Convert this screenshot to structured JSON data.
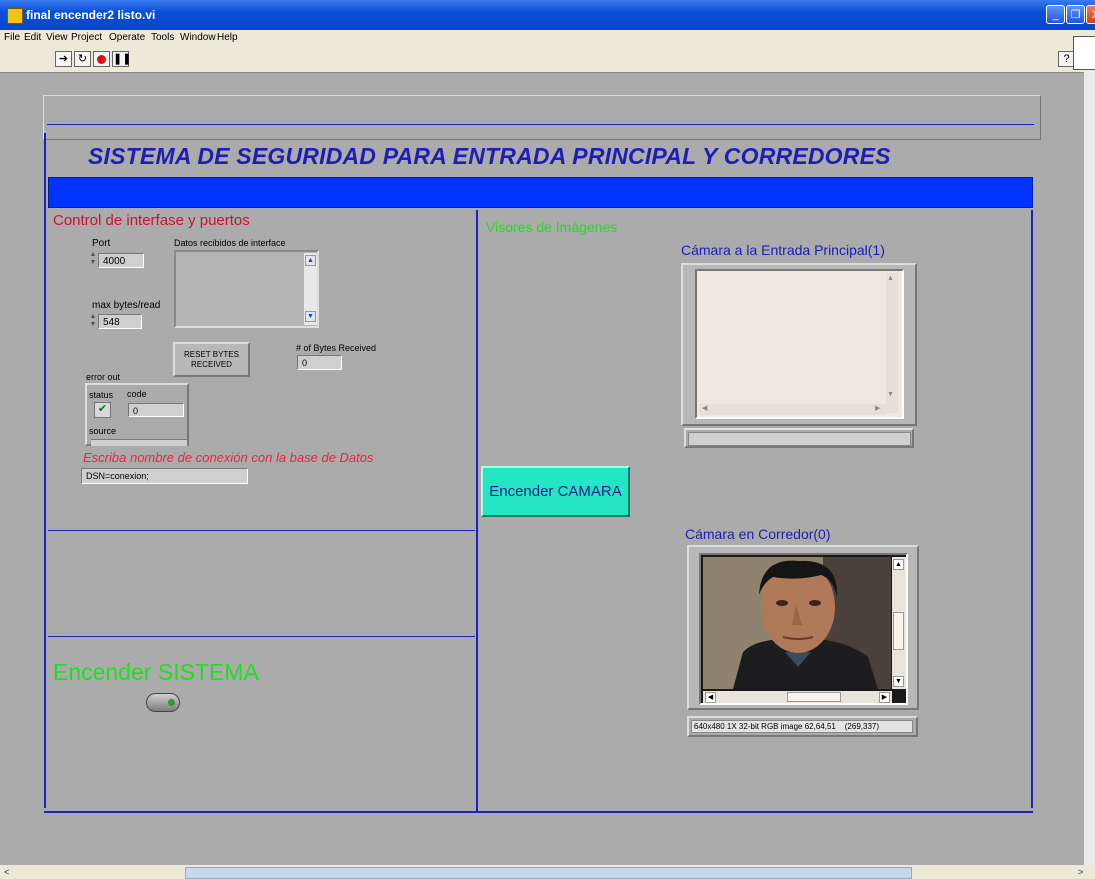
{
  "window": {
    "title": "final encender2 listo.vi",
    "controls": [
      "_",
      "❐",
      "X"
    ]
  },
  "menu": [
    "File",
    "Edit",
    "View",
    "Project",
    "Operate",
    "Tools",
    "Window",
    "Help"
  ],
  "panel": {
    "title": "SISTEMA DE SEGURIDAD PARA  ENTRADA PRINCIPAL Y CORREDORES",
    "left_section": {
      "heading": "Control de interfase y puertos",
      "port_label": "Port",
      "port_value": "4000",
      "max_bytes_label": "max bytes/read",
      "max_bytes_value": "548",
      "datos_label": "Datos recibidos de interface",
      "reset_button": "RESET BYTES RECEIVED",
      "bytes_received_label": "# of Bytes Received",
      "bytes_received_value": "0",
      "error_out": {
        "label": "error out",
        "status_label": "status",
        "code_label": "code",
        "code_value": "0",
        "source_label": "source"
      },
      "db_prompt": "Escriba nombre de conexión con la base de Datos",
      "db_value": "DSN=conexion;",
      "system_label": "Encender SISTEMA"
    },
    "right_section": {
      "heading": "Visores de Imágenes",
      "camera1_title": "Cámara a la Entrada Principal(1)",
      "camera0_title": "Cámara en Corredor(0)",
      "camera_button": "Encender CAMARA",
      "image_info": "640x480 1X 32-bit RGB image 62,64,51    (269,337)"
    }
  },
  "colors": {
    "panel_bg": "#ababab",
    "title_text": "#1e1eb4",
    "blue_bar": "#0033ff",
    "heading_red": "#cc1133",
    "heading_green": "#22dd22",
    "camera_button_bg": "#22e6c4"
  }
}
